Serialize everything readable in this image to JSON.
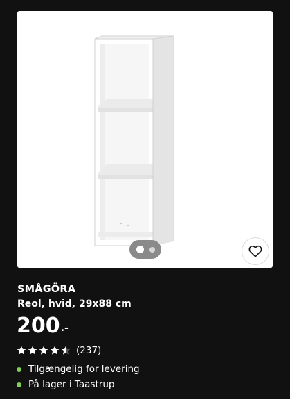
{
  "product": {
    "name": "SMÅGÖRA",
    "description": "Reol, hvid, 29x88 cm",
    "price": "200",
    "price_suffix": ".-",
    "image_icon": "shelf-unit-image"
  },
  "rating": {
    "stars": 4.5,
    "max_stars": 5,
    "count_label": "(237)"
  },
  "carousel": {
    "slide_count": 2,
    "active_index": 0
  },
  "availability": {
    "delivery": "Tilgængelig for levering",
    "store": "På lager i Taastrup"
  },
  "colors": {
    "background": "#111111",
    "text": "#ffffff",
    "status_available": "#7fcf5a"
  },
  "icons": {
    "favorite": "heart-outline-icon",
    "star": "star-icon"
  }
}
